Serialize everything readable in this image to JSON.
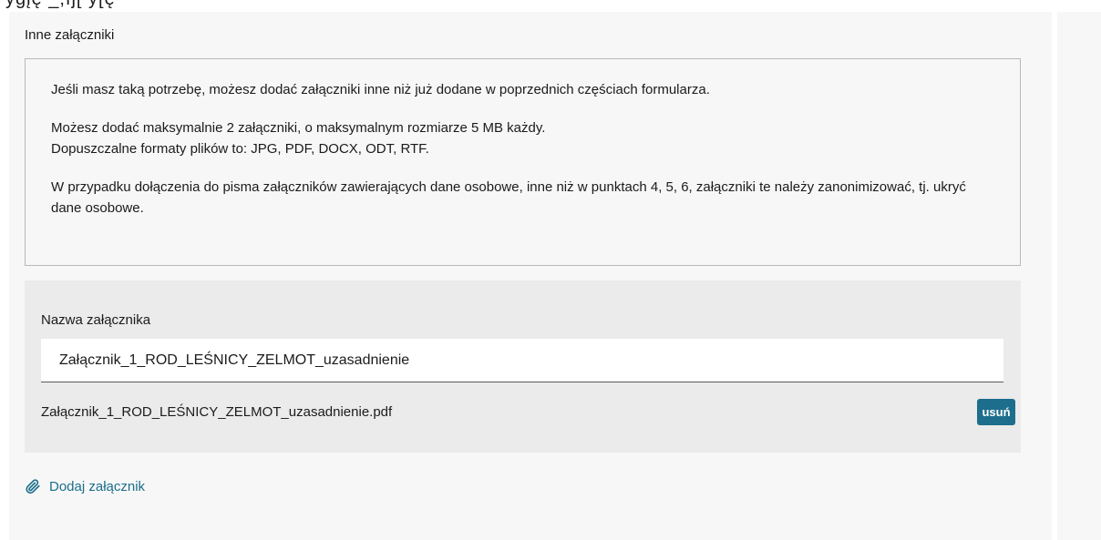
{
  "section": {
    "title": "Inne załączniki"
  },
  "info": {
    "paragraph_1": "Jeśli masz taką potrzebę, możesz dodać załączniki inne niż już dodane w poprzednich częściach formularza.",
    "paragraph_2_line_1": "Możesz dodać maksymalnie 2 załączniki, o maksymalnym rozmiarze 5 MB każdy.",
    "paragraph_2_line_2": "Dopuszczalne formaty plików to: JPG, PDF, DOCX, ODT, RTF.",
    "paragraph_3": "W przypadku dołączenia do pisma załączników zawierających dane osobowe, inne niż w punktach 4, 5, 6, załączniki te należy zanonimizować, tj. ukryć dane osobowe."
  },
  "attachment": {
    "name_label": "Nazwa załącznika",
    "name_value": "Załącznik_1_ROD_LEŚNICY_ZELMOT_uzasadnienie",
    "file_name": "Załącznik_1_ROD_LEŚNICY_ZELMOT_uzasadnienie.pdf",
    "remove_label": "usuń"
  },
  "actions": {
    "add_attachment_label": "Dodaj załącznik"
  },
  "colors": {
    "accent": "#1c6e8c",
    "panel_bg": "#f7f7f7",
    "card_bg": "#ebebeb"
  },
  "icons": {
    "add_attachment": "paperclip-icon"
  }
}
